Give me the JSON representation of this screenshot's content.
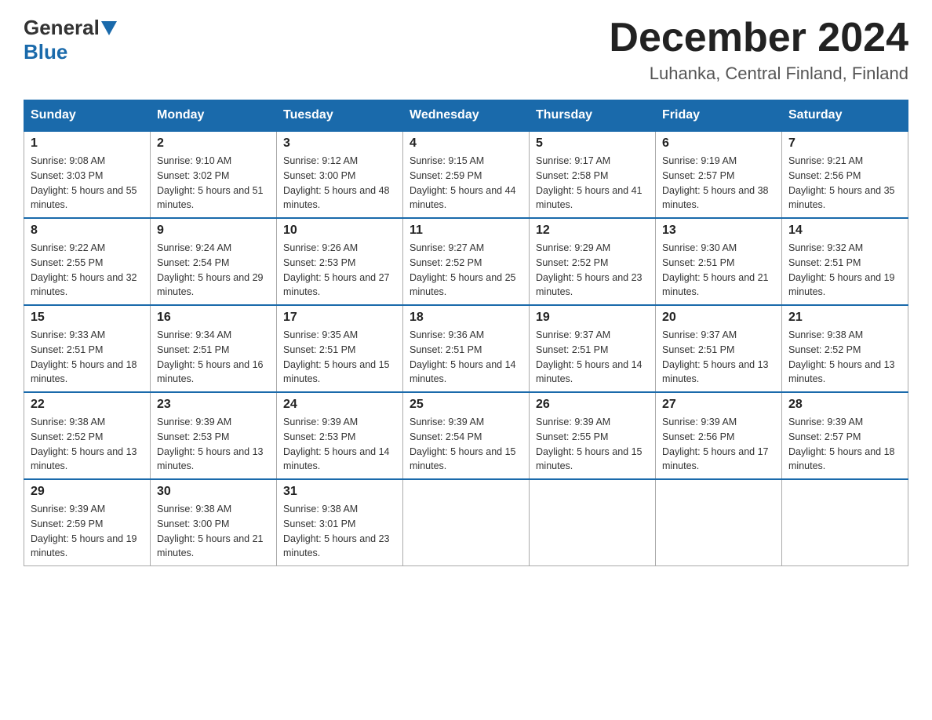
{
  "header": {
    "logo": {
      "general": "General",
      "blue": "Blue"
    },
    "title": "December 2024",
    "location": "Luhanka, Central Finland, Finland"
  },
  "days_of_week": [
    "Sunday",
    "Monday",
    "Tuesday",
    "Wednesday",
    "Thursday",
    "Friday",
    "Saturday"
  ],
  "weeks": [
    [
      {
        "day": "1",
        "sunrise": "9:08 AM",
        "sunset": "3:03 PM",
        "daylight": "5 hours and 55 minutes."
      },
      {
        "day": "2",
        "sunrise": "9:10 AM",
        "sunset": "3:02 PM",
        "daylight": "5 hours and 51 minutes."
      },
      {
        "day": "3",
        "sunrise": "9:12 AM",
        "sunset": "3:00 PM",
        "daylight": "5 hours and 48 minutes."
      },
      {
        "day": "4",
        "sunrise": "9:15 AM",
        "sunset": "2:59 PM",
        "daylight": "5 hours and 44 minutes."
      },
      {
        "day": "5",
        "sunrise": "9:17 AM",
        "sunset": "2:58 PM",
        "daylight": "5 hours and 41 minutes."
      },
      {
        "day": "6",
        "sunrise": "9:19 AM",
        "sunset": "2:57 PM",
        "daylight": "5 hours and 38 minutes."
      },
      {
        "day": "7",
        "sunrise": "9:21 AM",
        "sunset": "2:56 PM",
        "daylight": "5 hours and 35 minutes."
      }
    ],
    [
      {
        "day": "8",
        "sunrise": "9:22 AM",
        "sunset": "2:55 PM",
        "daylight": "5 hours and 32 minutes."
      },
      {
        "day": "9",
        "sunrise": "9:24 AM",
        "sunset": "2:54 PM",
        "daylight": "5 hours and 29 minutes."
      },
      {
        "day": "10",
        "sunrise": "9:26 AM",
        "sunset": "2:53 PM",
        "daylight": "5 hours and 27 minutes."
      },
      {
        "day": "11",
        "sunrise": "9:27 AM",
        "sunset": "2:52 PM",
        "daylight": "5 hours and 25 minutes."
      },
      {
        "day": "12",
        "sunrise": "9:29 AM",
        "sunset": "2:52 PM",
        "daylight": "5 hours and 23 minutes."
      },
      {
        "day": "13",
        "sunrise": "9:30 AM",
        "sunset": "2:51 PM",
        "daylight": "5 hours and 21 minutes."
      },
      {
        "day": "14",
        "sunrise": "9:32 AM",
        "sunset": "2:51 PM",
        "daylight": "5 hours and 19 minutes."
      }
    ],
    [
      {
        "day": "15",
        "sunrise": "9:33 AM",
        "sunset": "2:51 PM",
        "daylight": "5 hours and 18 minutes."
      },
      {
        "day": "16",
        "sunrise": "9:34 AM",
        "sunset": "2:51 PM",
        "daylight": "5 hours and 16 minutes."
      },
      {
        "day": "17",
        "sunrise": "9:35 AM",
        "sunset": "2:51 PM",
        "daylight": "5 hours and 15 minutes."
      },
      {
        "day": "18",
        "sunrise": "9:36 AM",
        "sunset": "2:51 PM",
        "daylight": "5 hours and 14 minutes."
      },
      {
        "day": "19",
        "sunrise": "9:37 AM",
        "sunset": "2:51 PM",
        "daylight": "5 hours and 14 minutes."
      },
      {
        "day": "20",
        "sunrise": "9:37 AM",
        "sunset": "2:51 PM",
        "daylight": "5 hours and 13 minutes."
      },
      {
        "day": "21",
        "sunrise": "9:38 AM",
        "sunset": "2:52 PM",
        "daylight": "5 hours and 13 minutes."
      }
    ],
    [
      {
        "day": "22",
        "sunrise": "9:38 AM",
        "sunset": "2:52 PM",
        "daylight": "5 hours and 13 minutes."
      },
      {
        "day": "23",
        "sunrise": "9:39 AM",
        "sunset": "2:53 PM",
        "daylight": "5 hours and 13 minutes."
      },
      {
        "day": "24",
        "sunrise": "9:39 AM",
        "sunset": "2:53 PM",
        "daylight": "5 hours and 14 minutes."
      },
      {
        "day": "25",
        "sunrise": "9:39 AM",
        "sunset": "2:54 PM",
        "daylight": "5 hours and 15 minutes."
      },
      {
        "day": "26",
        "sunrise": "9:39 AM",
        "sunset": "2:55 PM",
        "daylight": "5 hours and 15 minutes."
      },
      {
        "day": "27",
        "sunrise": "9:39 AM",
        "sunset": "2:56 PM",
        "daylight": "5 hours and 17 minutes."
      },
      {
        "day": "28",
        "sunrise": "9:39 AM",
        "sunset": "2:57 PM",
        "daylight": "5 hours and 18 minutes."
      }
    ],
    [
      {
        "day": "29",
        "sunrise": "9:39 AM",
        "sunset": "2:59 PM",
        "daylight": "5 hours and 19 minutes."
      },
      {
        "day": "30",
        "sunrise": "9:38 AM",
        "sunset": "3:00 PM",
        "daylight": "5 hours and 21 minutes."
      },
      {
        "day": "31",
        "sunrise": "9:38 AM",
        "sunset": "3:01 PM",
        "daylight": "5 hours and 23 minutes."
      },
      null,
      null,
      null,
      null
    ]
  ]
}
